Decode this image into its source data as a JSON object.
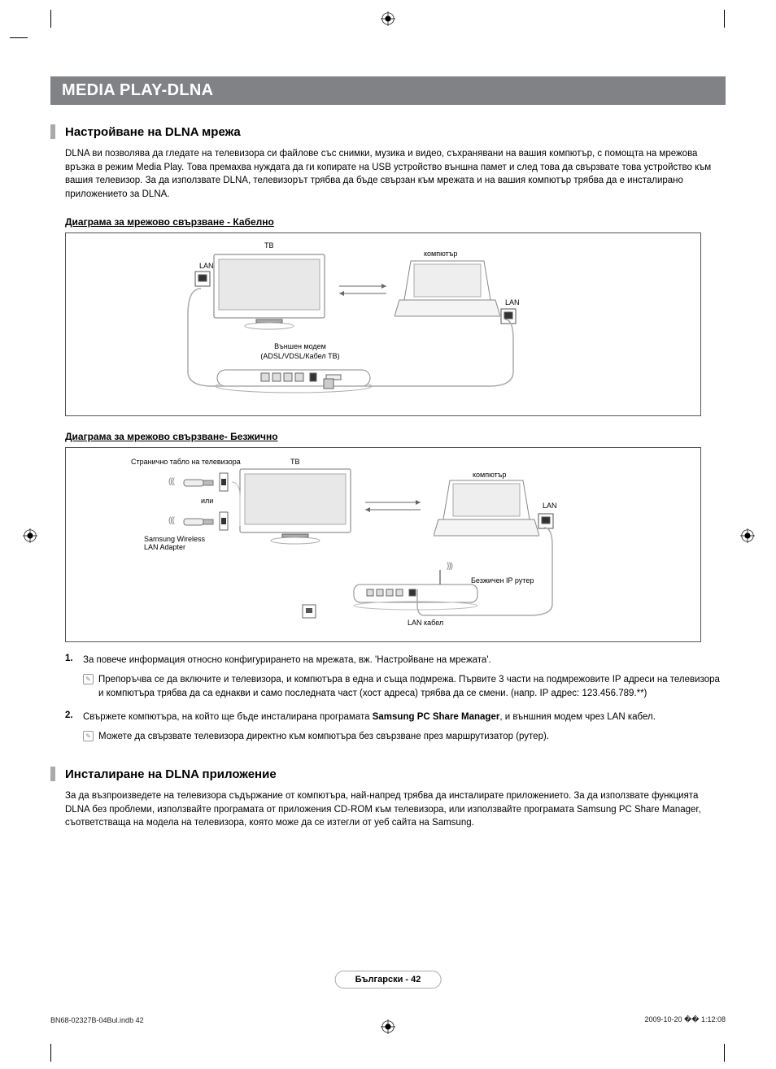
{
  "banner": "MEDIA PLAY-DLNA",
  "section1": {
    "title": "Настройване на DLNA мрежа",
    "para": "DLNA ви позволява да гледате на телевизора си файлове със снимки, музика и видео, съхранявани на вашия компютър, с помощта на мрежова връзка в режим Media Play. Това премахва нуждата да ги копирате на USB устройство външна памет и след това да свързвате това устройство към вашия телевизор. За да използвате DLNA, телевизорът трябва да бъде свързан към мрежата и на вашия компютър трябва да е инсталирано приложението за DLNA."
  },
  "sub1": "Диаграма за мрежово свързване - Кабелно",
  "diagram1": {
    "tv": "ТВ",
    "lan1": "LAN",
    "lan2": "LAN",
    "computer": "компютър",
    "modem_top": "Външен модем",
    "modem_bottom": "(ADSL/VDSL/Кабел ТВ)"
  },
  "sub2": "Диаграма за мрежово свързване- Безжично",
  "diagram2": {
    "panel": "Странично табло на телевизора",
    "tv": "ТВ",
    "computer": "компютър",
    "or": "или",
    "adapter": "Samsung Wireless LAN Adapter",
    "lan": "LAN",
    "router": "Безжичен IP рутер",
    "lan_cable": "LAN кабел"
  },
  "list": {
    "n1": "1.",
    "i1": "За повече информация относно конфигурирането на мрежата, вж. 'Настройване на мрежата'.",
    "note1": "Препоръчва се да включите и телевизора, и компютъра в една и съща подмрежа. Първите 3 части на подмрежовите IP адреси на телевизора и компютъра трябва да са еднакви и само последната част (хост адреса) трябва да се смени. (напр. IP адрес: 123.456.789.**)",
    "n2": "2.",
    "i2_a": "Свържете компютъра, на който ще бъде инсталирана програмата ",
    "i2_b": "Samsung PC Share Manager",
    "i2_c": ", и външния модем чрез LAN кабел.",
    "note2": "Можете да свързвате телевизора директно към компютъра без свързване през маршрутизатор (рутер)."
  },
  "section2": {
    "title": "Инсталиране на DLNA приложение",
    "para": "За да възпроизведете на телевизора съдържание от компютъра, най-напред трябва да инсталирате приложението. За да използвате функцията DLNA без проблеми, използвайте програмата от приложения CD-ROM към телевизора, или използвайте програмата Samsung PC Share Manager, съответстваща на модела на телевизора, която може да се изтегли от уеб сайта на Samsung."
  },
  "footer": {
    "page": "Български - 42",
    "doc": "BN68-02327B-04Bul.indb   42",
    "ts": "2009-10-20   �� 1:12:08"
  }
}
